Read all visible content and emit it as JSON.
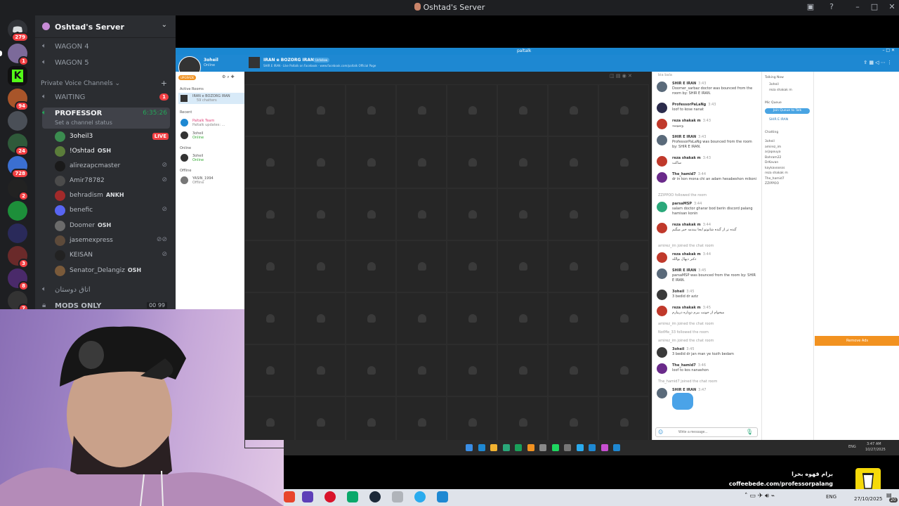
{
  "window": {
    "title": "Oshtad's Server"
  },
  "rail": {
    "home_badge": "279",
    "items": [
      {
        "badge": "1"
      },
      {
        "badge": ""
      },
      {
        "badge": "94"
      },
      {
        "badge": ""
      },
      {
        "badge": "24"
      },
      {
        "badge": "728"
      },
      {
        "badge": "2"
      },
      {
        "badge": ""
      },
      {
        "badge": ""
      },
      {
        "badge": "3"
      },
      {
        "badge": "8"
      },
      {
        "badge": "7"
      }
    ]
  },
  "server": {
    "name": "Oshtad's Server",
    "channels_top": [
      {
        "label": "WAGON 4"
      },
      {
        "label": "WAGON 5"
      }
    ],
    "category": "Private Voice Channels",
    "waiting": {
      "label": "WAITING",
      "badge": "1"
    },
    "professor": {
      "label": "PROFESSOR",
      "timer": "6:35:26",
      "status": "Set a channel status"
    },
    "users": [
      {
        "name": "3oheil3",
        "tag": "",
        "live": "LIVE",
        "color": "#3b8c4f"
      },
      {
        "name": "!Oshtad",
        "tag": "OSH",
        "live": "",
        "color": "#5b7d3a"
      },
      {
        "name": "alirezapcmaster",
        "tag": "",
        "live": "",
        "color": "#1a1a1a"
      },
      {
        "name": "Amir78782",
        "tag": "",
        "live": "",
        "color": "#4b4b4b"
      },
      {
        "name": "behradism",
        "tag": "ANKH",
        "live": "",
        "color": "#a12a2a"
      },
      {
        "name": "benefic",
        "tag": "",
        "live": "",
        "color": "#5865f2"
      },
      {
        "name": "Doomer",
        "tag": "OSH",
        "live": "",
        "color": "#6b6b6b"
      },
      {
        "name": "jasemexpress",
        "tag": "",
        "live": "",
        "color": "#5d4a3a"
      },
      {
        "name": "KEISAN",
        "tag": "",
        "live": "",
        "color": "#222"
      },
      {
        "name": "Senator_Delangiz",
        "tag": "OSH",
        "live": "",
        "color": "#7a5a3a"
      }
    ],
    "channels_bottom": [
      {
        "label": "اتاق دوستان"
      },
      {
        "label": "MODS ONLY",
        "count": "00  99"
      }
    ]
  },
  "paltalk": {
    "brand": "paltalk",
    "user": {
      "name": "3oheil",
      "status": "Online",
      "pill": "UPGRADE"
    },
    "room": {
      "name": "IRAN e BOZORG IRAN",
      "pill": "Unfollow",
      "meta": "SHIR E IRAN · Like Paltalk on Facebook · www.facebook.com/paltalk Official Page"
    },
    "sidebar": {
      "active_label": "Active Rooms",
      "active_room": "IRAN e BOZORG IRAN",
      "active_sub": "59 chatters",
      "recent_label": "Recent",
      "recent": [
        {
          "name": "Paltalk Team",
          "sub": "Paltalk updates: ..."
        },
        {
          "name": "3oheil",
          "sub": "Online"
        }
      ],
      "online_label": "Online",
      "online": [
        {
          "name": "3oheil",
          "sub": "Online"
        }
      ],
      "offline_label": "Offline",
      "offline": [
        {
          "name": "YASIN_1994",
          "sub": "Offline"
        }
      ]
    },
    "chat": [
      {
        "kind": "sys",
        "text": "bia bala"
      },
      {
        "kind": "msg",
        "name": "SHIR E IRAN",
        "time": "3:43",
        "text": "Doomer_sarbaz doctor was bounced from the room by: SHIR E IRAN.",
        "color": "#5a6a7a"
      },
      {
        "kind": "msg",
        "name": "ProfessorPaLaNg",
        "time": "3:43",
        "text": "loof to kose nanat",
        "color": "#2b2b4b"
      },
      {
        "kind": "msg",
        "name": "reza shakak m",
        "time": "3:43",
        "text": "وسوسه",
        "color": "#c0392b"
      },
      {
        "kind": "msg",
        "name": "SHIR E IRAN",
        "time": "3:43",
        "text": "ProfessorPaLaNg was bounced from the room by: SHIR E IRAN.",
        "color": "#5a6a7a"
      },
      {
        "kind": "msg",
        "name": "reza shakak m",
        "time": "3:43",
        "text": "ساکت",
        "color": "#c0392b"
      },
      {
        "kind": "msg",
        "name": "The_hamid7",
        "time": "3:44",
        "text": "dr in kon mona chi an adam hesabeshon mikoni",
        "color": "#6a2a8a"
      },
      {
        "kind": "sys",
        "text": "ZZIPPOO followed the room"
      },
      {
        "kind": "msg",
        "name": "parsaMSP",
        "time": "3:44",
        "text": "salam doctor gharar bod berin discord palang hamisan konin",
        "color": "#2aa87a"
      },
      {
        "kind": "msg",
        "name": "reza shakak m",
        "time": "3:44",
        "text": "گنده تر از گنده شانوتو ایجا بیندمه خبر میگیم",
        "color": "#c0392b"
      },
      {
        "kind": "sys",
        "text": "amirez_im joined the chat room"
      },
      {
        "kind": "msg",
        "name": "reza shakak m",
        "time": "3:44",
        "text": "دکتر دیهال بوالله",
        "color": "#c0392b"
      },
      {
        "kind": "msg",
        "name": "SHIR E IRAN",
        "time": "3:45",
        "text": "parsaMSP was bounced from the room by: SHIR E IRAN.",
        "color": "#5a6a7a"
      },
      {
        "kind": "msg",
        "name": "3oheil",
        "time": "3:45",
        "text": "3 bedid dr aziz",
        "color": "#3a3a3a"
      },
      {
        "kind": "msg",
        "name": "reza shakak m",
        "time": "3:45",
        "text": "میخوام از خونت ببرم دوباره دربیارم",
        "color": "#c0392b"
      },
      {
        "kind": "sys",
        "text": "amirez_im joined the chat room"
      },
      {
        "kind": "sys",
        "text": "NotMe_33 followed the room"
      },
      {
        "kind": "sys",
        "text": "amirez_im joined the chat room"
      },
      {
        "kind": "msg",
        "name": "3oheil",
        "time": "3:45",
        "text": "3 bedid dr jan man ye tozih bedam",
        "color": "#3a3a3a"
      },
      {
        "kind": "msg",
        "name": "The_hamid7",
        "time": "3:46",
        "text": "loof to kos nanashon",
        "color": "#6a2a8a"
      },
      {
        "kind": "sys",
        "text": "The_hamid7 joined the chat room"
      },
      {
        "kind": "msg",
        "name": "SHIR E IRAN",
        "time": "3:47",
        "text": "",
        "color": "#5a6a7a"
      }
    ],
    "input_placeholder": "Write a message...",
    "talking": {
      "label": "Talking Now",
      "users": [
        "3oheil",
        "reza shakak m"
      ],
      "queue_label": "Mic Queue",
      "queue_button": "Join Queue to Talk",
      "queue_user": "SHIR E IRAN",
      "chatting_label": "Chatting",
      "chatting": [
        "3oheil",
        "amirez_im",
        "arjapouya",
        "Bahram22",
        "DrKavan",
        "kaykavoosss",
        "reza shakak m",
        "The_hamid7",
        "ZZIPPOO"
      ]
    },
    "ads_button": "Remove Ads"
  },
  "taskbar": {
    "lang": "ENG",
    "time": "3:47 AM",
    "date": "10/27/2025"
  },
  "host_taskbar": {
    "lang": "ENG",
    "date": "27/10/2025",
    "badge": "20"
  },
  "coffee": {
    "line1": "برام قهوه بخرا",
    "line2": "coffeebede.com/professorpalang"
  }
}
